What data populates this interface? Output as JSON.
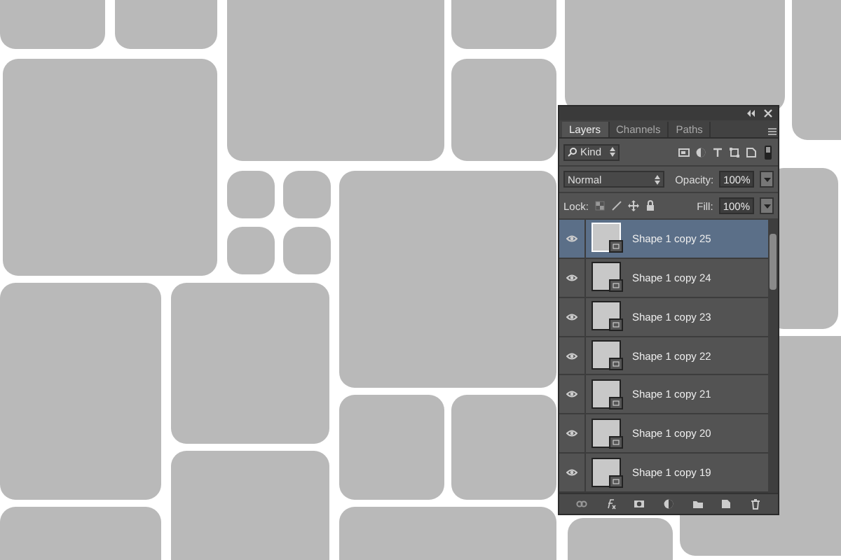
{
  "panel": {
    "tabs": [
      {
        "label": "Layers",
        "selected": true
      },
      {
        "label": "Channels",
        "selected": false
      },
      {
        "label": "Paths",
        "selected": false
      }
    ],
    "filter": {
      "value": "Kind"
    },
    "blend_mode": "Normal",
    "opacity_label": "Opacity:",
    "opacity": "100%",
    "lock_label": "Lock:",
    "fill_label": "Fill:",
    "fill": "100%",
    "layers": [
      {
        "name": "Shape 1 copy 25",
        "visible": true,
        "selected": true
      },
      {
        "name": "Shape 1 copy 24",
        "visible": true,
        "selected": false
      },
      {
        "name": "Shape 1 copy 23",
        "visible": true,
        "selected": false
      },
      {
        "name": "Shape 1 copy 22",
        "visible": true,
        "selected": false
      },
      {
        "name": "Shape 1 copy 21",
        "visible": true,
        "selected": false
      },
      {
        "name": "Shape 1 copy 20",
        "visible": true,
        "selected": false
      },
      {
        "name": "Shape 1 copy 19",
        "visible": true,
        "selected": false
      }
    ]
  }
}
